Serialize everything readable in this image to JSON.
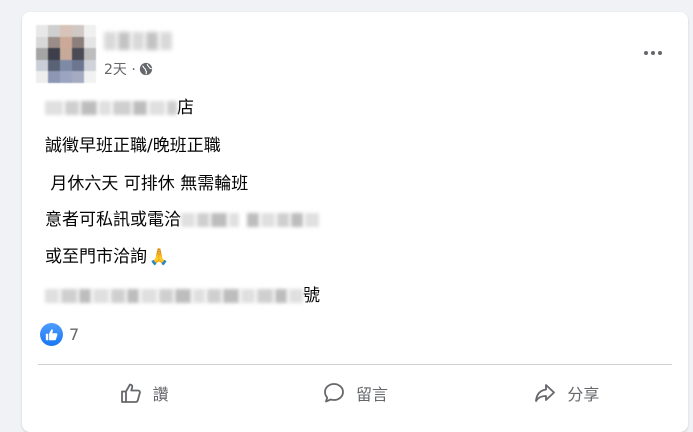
{
  "post": {
    "timestamp": "2天 ·",
    "lines": {
      "l1_suffix": "店",
      "l2": "誠徵早班正職/晚班正職",
      "l3": " 月休六天 可排休 無需輪班",
      "l4": "意者可私訊或電洽",
      "l5": "或至門市洽詢",
      "l6_suffix": "號"
    },
    "emoji": "🙏"
  },
  "reactions": {
    "count": "7"
  },
  "actions": {
    "like_label": "讚",
    "comment_label": "留言",
    "share_label": "分享"
  },
  "icons": [
    "globe-icon",
    "more-options-icon",
    "like-reaction-icon",
    "thumbs-up-icon",
    "comment-icon",
    "share-icon",
    "pray-icon"
  ],
  "colors": {
    "background": "#f0f2f5",
    "card": "#ffffff",
    "secondary_text": "#65676b",
    "like_blue": "#1877f2"
  }
}
